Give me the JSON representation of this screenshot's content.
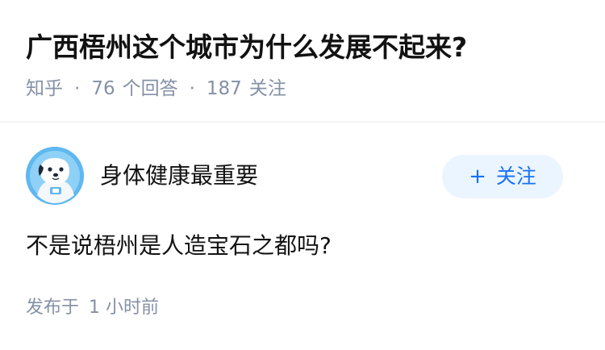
{
  "question": {
    "title": "广西梧州这个城市为什么发展不起来?",
    "meta": {
      "source": "知乎",
      "separator": "·",
      "answer_count": "76",
      "answer_label": "个回答",
      "follower_count": "187",
      "follower_label": "关注"
    }
  },
  "answer": {
    "author": {
      "avatar_icon": "cartoon-dog-astronaut-avatar",
      "name": "身体健康最重要",
      "follow_plus": "+",
      "follow_label": "关注"
    },
    "content": "不是说梧州是人造宝石之都吗?",
    "published": {
      "label": "发布于",
      "time": "1 小时前"
    }
  },
  "colors": {
    "title": "#121212",
    "meta_gray": "#8590a6",
    "follow_bg": "#ebf5ff",
    "follow_text": "#1772f6",
    "avatar_bg": "#5fb8f0"
  }
}
